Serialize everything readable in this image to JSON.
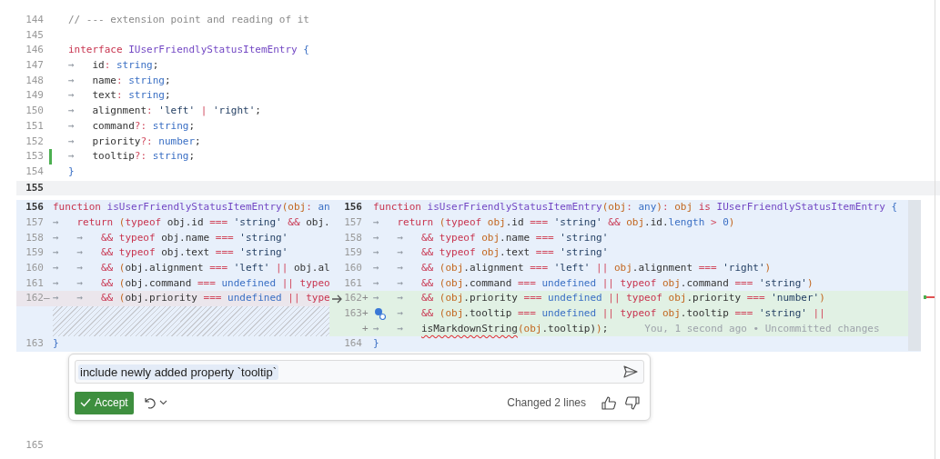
{
  "editor": {
    "lines_before": [
      {
        "number": "144",
        "modified": false,
        "tokens": [
          {
            "kind": "comment",
            "text": "// --- extension point and reading of it"
          }
        ]
      },
      {
        "number": "145",
        "modified": false
      },
      {
        "number": "146",
        "modified": false,
        "tokens": [
          {
            "kind": "kw",
            "text": "interface"
          },
          {
            "kind": "type",
            "text": " IUserFriendlyStatusItemEntry"
          },
          {
            "kind": "brace",
            "text": " {"
          }
        ]
      },
      {
        "number": "147",
        "modified": false,
        "tokens": [
          {
            "kind": "tab",
            "text": "→"
          },
          {
            "kind": "p",
            "text": "id"
          },
          {
            "kind": "op",
            "text": ":"
          },
          {
            "kind": "tn",
            "text": " string"
          },
          {
            "kind": "p",
            "text": ";"
          }
        ]
      },
      {
        "number": "148",
        "modified": false,
        "tokens": [
          {
            "kind": "tab",
            "text": "→"
          },
          {
            "kind": "p",
            "text": "name"
          },
          {
            "kind": "op",
            "text": ":"
          },
          {
            "kind": "tn",
            "text": " string"
          },
          {
            "kind": "p",
            "text": ";"
          }
        ]
      },
      {
        "number": "149",
        "modified": false,
        "tokens": [
          {
            "kind": "tab",
            "text": "→"
          },
          {
            "kind": "p",
            "text": "text"
          },
          {
            "kind": "op",
            "text": ":"
          },
          {
            "kind": "tn",
            "text": " string"
          },
          {
            "kind": "p",
            "text": ";"
          }
        ]
      },
      {
        "number": "150",
        "modified": false,
        "tokens": [
          {
            "kind": "tab",
            "text": "→"
          },
          {
            "kind": "p",
            "text": "alignment"
          },
          {
            "kind": "op",
            "text": ":"
          },
          {
            "kind": "str",
            "text": " 'left'"
          },
          {
            "kind": "op",
            "text": " |"
          },
          {
            "kind": "str",
            "text": " 'right'"
          },
          {
            "kind": "p",
            "text": ";"
          }
        ]
      },
      {
        "number": "151",
        "modified": false,
        "tokens": [
          {
            "kind": "tab",
            "text": "→"
          },
          {
            "kind": "p",
            "text": "command"
          },
          {
            "kind": "op",
            "text": "?:"
          },
          {
            "kind": "tn",
            "text": " string"
          },
          {
            "kind": "p",
            "text": ";"
          }
        ]
      },
      {
        "number": "152",
        "modified": false,
        "tokens": [
          {
            "kind": "tab",
            "text": "→"
          },
          {
            "kind": "p",
            "text": "priority"
          },
          {
            "kind": "op",
            "text": "?:"
          },
          {
            "kind": "tn",
            "text": " number"
          },
          {
            "kind": "p",
            "text": ";"
          }
        ]
      },
      {
        "number": "153",
        "modified": true,
        "tokens": [
          {
            "kind": "tab",
            "text": "→"
          },
          {
            "kind": "p",
            "text": "tooltip"
          },
          {
            "kind": "op",
            "text": "?:"
          },
          {
            "kind": "tn",
            "text": " string"
          },
          {
            "kind": "p",
            "text": ";"
          }
        ]
      },
      {
        "number": "154",
        "modified": false,
        "tokens": [
          {
            "kind": "brace",
            "text": "}"
          }
        ]
      }
    ],
    "current_line": {
      "number": "155"
    },
    "diff": {
      "original": [
        {
          "kind": "line",
          "number": "156",
          "current": true,
          "deleted": false,
          "tokens": [
            {
              "kind": "kw",
              "text": "function"
            },
            {
              "kind": "type",
              "text": " isUserFriendlyStatusItemEntry"
            },
            {
              "kind": "paren",
              "text": "("
            },
            {
              "kind": "obj",
              "text": "obj"
            },
            {
              "kind": "op",
              "text": ":"
            },
            {
              "kind": "tn",
              "text": " an"
            }
          ]
        },
        {
          "kind": "line",
          "number": "157",
          "current": false,
          "deleted": false,
          "tokens": [
            {
              "kind": "tab",
              "text": "→"
            },
            {
              "kind": "kw",
              "text": "return"
            },
            {
              "kind": "paren",
              "text": " ("
            },
            {
              "kind": "kw",
              "text": "typeof"
            },
            {
              "kind": "p",
              "text": " obj.id "
            },
            {
              "kind": "op",
              "text": "==="
            },
            {
              "kind": "str",
              "text": " 'string'"
            },
            {
              "kind": "kw",
              "text": " &&"
            },
            {
              "kind": "p",
              "text": " obj."
            }
          ]
        },
        {
          "kind": "line",
          "number": "158",
          "current": false,
          "deleted": false,
          "tokens": [
            {
              "kind": "tab",
              "text": "→"
            },
            {
              "kind": "tab",
              "text": "→"
            },
            {
              "kind": "kw",
              "text": "&&"
            },
            {
              "kind": "kw",
              "text": " typeof"
            },
            {
              "kind": "p",
              "text": " obj.name "
            },
            {
              "kind": "op",
              "text": "==="
            },
            {
              "kind": "str",
              "text": " 'string'"
            }
          ]
        },
        {
          "kind": "line",
          "number": "159",
          "current": false,
          "deleted": false,
          "tokens": [
            {
              "kind": "tab",
              "text": "→"
            },
            {
              "kind": "tab",
              "text": "→"
            },
            {
              "kind": "kw",
              "text": "&&"
            },
            {
              "kind": "kw",
              "text": " typeof"
            },
            {
              "kind": "p",
              "text": " obj.text "
            },
            {
              "kind": "op",
              "text": "==="
            },
            {
              "kind": "str",
              "text": " 'string'"
            }
          ]
        },
        {
          "kind": "line",
          "number": "160",
          "current": false,
          "deleted": false,
          "tokens": [
            {
              "kind": "tab",
              "text": "→"
            },
            {
              "kind": "tab",
              "text": "→"
            },
            {
              "kind": "kw",
              "text": "&&"
            },
            {
              "kind": "paren",
              "text": " ("
            },
            {
              "kind": "p",
              "text": "obj.alignment "
            },
            {
              "kind": "op",
              "text": "==="
            },
            {
              "kind": "str",
              "text": " 'left'"
            },
            {
              "kind": "op",
              "text": " ||"
            },
            {
              "kind": "p",
              "text": " obj.al"
            }
          ]
        },
        {
          "kind": "line",
          "number": "161",
          "current": false,
          "deleted": false,
          "tokens": [
            {
              "kind": "tab",
              "text": "→"
            },
            {
              "kind": "tab",
              "text": "→"
            },
            {
              "kind": "kw",
              "text": "&&"
            },
            {
              "kind": "paren",
              "text": " ("
            },
            {
              "kind": "p",
              "text": "obj.command "
            },
            {
              "kind": "op",
              "text": "==="
            },
            {
              "kind": "tn",
              "text": " undefined"
            },
            {
              "kind": "op",
              "text": " ||"
            },
            {
              "kind": "kw",
              "text": " typeo"
            }
          ]
        },
        {
          "kind": "line",
          "number": "162",
          "current": false,
          "deleted": true,
          "marker": "—",
          "tokens": [
            {
              "kind": "tab",
              "text": "→"
            },
            {
              "kind": "tab",
              "text": "→"
            },
            {
              "kind": "kw",
              "text": "&&"
            },
            {
              "kind": "paren",
              "text": " ("
            },
            {
              "kind": "p",
              "text": "obj.priority "
            },
            {
              "kind": "op",
              "text": "==="
            },
            {
              "kind": "tn",
              "text": " undefined"
            },
            {
              "kind": "op",
              "text": " ||"
            },
            {
              "kind": "kw",
              "text": " type"
            }
          ]
        },
        {
          "kind": "filler"
        },
        {
          "kind": "filler"
        },
        {
          "kind": "line",
          "number": "163",
          "current": false,
          "deleted": false,
          "tokens": [
            {
              "kind": "brace",
              "text": "}"
            }
          ]
        }
      ],
      "modified": [
        {
          "kind": "line",
          "number": "156",
          "current": true,
          "added": false,
          "tokens": [
            {
              "kind": "kw",
              "text": "function"
            },
            {
              "kind": "type",
              "text": " isUserFriendlyStatusItemEntry"
            },
            {
              "kind": "paren",
              "text": "("
            },
            {
              "kind": "obj",
              "text": "obj"
            },
            {
              "kind": "op",
              "text": ":"
            },
            {
              "kind": "tn",
              "text": " any"
            },
            {
              "kind": "paren",
              "text": ")"
            },
            {
              "kind": "op",
              "text": ":"
            },
            {
              "kind": "obj",
              "text": " obj"
            },
            {
              "kind": "kw",
              "text": " is"
            },
            {
              "kind": "type",
              "text": " IUserFriendlyStatusItemEntry"
            },
            {
              "kind": "brace",
              "text": " {"
            }
          ]
        },
        {
          "kind": "line",
          "number": "157",
          "current": false,
          "added": false,
          "tokens": [
            {
              "kind": "tab",
              "text": "→"
            },
            {
              "kind": "kw",
              "text": "return"
            },
            {
              "kind": "paren",
              "text": " ("
            },
            {
              "kind": "kw",
              "text": "typeof"
            },
            {
              "kind": "obj",
              "text": " obj"
            },
            {
              "kind": "p",
              "text": ".id "
            },
            {
              "kind": "op",
              "text": "==="
            },
            {
              "kind": "str",
              "text": " 'string'"
            },
            {
              "kind": "kw",
              "text": " &&"
            },
            {
              "kind": "obj",
              "text": " obj"
            },
            {
              "kind": "p",
              "text": ".id."
            },
            {
              "kind": "tn",
              "text": "length"
            },
            {
              "kind": "op",
              "text": " >"
            },
            {
              "kind": "tn",
              "text": " 0"
            },
            {
              "kind": "paren",
              "text": ")"
            }
          ]
        },
        {
          "kind": "line",
          "number": "158",
          "current": false,
          "added": false,
          "tokens": [
            {
              "kind": "tab",
              "text": "→"
            },
            {
              "kind": "tab",
              "text": "→"
            },
            {
              "kind": "kw",
              "text": "&&"
            },
            {
              "kind": "kw",
              "text": " typeof"
            },
            {
              "kind": "obj",
              "text": " obj"
            },
            {
              "kind": "p",
              "text": ".name "
            },
            {
              "kind": "op",
              "text": "==="
            },
            {
              "kind": "str",
              "text": " 'string'"
            }
          ]
        },
        {
          "kind": "line",
          "number": "159",
          "current": false,
          "added": false,
          "tokens": [
            {
              "kind": "tab",
              "text": "→"
            },
            {
              "kind": "tab",
              "text": "→"
            },
            {
              "kind": "kw",
              "text": "&&"
            },
            {
              "kind": "kw",
              "text": " typeof"
            },
            {
              "kind": "obj",
              "text": " obj"
            },
            {
              "kind": "p",
              "text": ".text "
            },
            {
              "kind": "op",
              "text": "==="
            },
            {
              "kind": "str",
              "text": " 'string'"
            }
          ]
        },
        {
          "kind": "line",
          "number": "160",
          "current": false,
          "added": false,
          "tokens": [
            {
              "kind": "tab",
              "text": "→"
            },
            {
              "kind": "tab",
              "text": "→"
            },
            {
              "kind": "kw",
              "text": "&&"
            },
            {
              "kind": "paren",
              "text": " ("
            },
            {
              "kind": "obj",
              "text": "obj"
            },
            {
              "kind": "p",
              "text": ".alignment "
            },
            {
              "kind": "op",
              "text": "==="
            },
            {
              "kind": "str",
              "text": " 'left'"
            },
            {
              "kind": "op",
              "text": " ||"
            },
            {
              "kind": "obj",
              "text": " obj"
            },
            {
              "kind": "p",
              "text": ".alignment "
            },
            {
              "kind": "op",
              "text": "==="
            },
            {
              "kind": "str",
              "text": " 'right'"
            },
            {
              "kind": "paren",
              "text": ")"
            }
          ]
        },
        {
          "kind": "line",
          "number": "161",
          "current": false,
          "added": false,
          "tokens": [
            {
              "kind": "tab",
              "text": "→"
            },
            {
              "kind": "tab",
              "text": "→"
            },
            {
              "kind": "kw",
              "text": "&&"
            },
            {
              "kind": "paren",
              "text": " ("
            },
            {
              "kind": "obj",
              "text": "obj"
            },
            {
              "kind": "p",
              "text": ".command "
            },
            {
              "kind": "op",
              "text": "==="
            },
            {
              "kind": "tn",
              "text": " undefined"
            },
            {
              "kind": "op",
              "text": " ||"
            },
            {
              "kind": "kw",
              "text": " typeof"
            },
            {
              "kind": "obj",
              "text": " obj"
            },
            {
              "kind": "p",
              "text": ".command "
            },
            {
              "kind": "op",
              "text": "==="
            },
            {
              "kind": "str",
              "text": " 'string'"
            },
            {
              "kind": "paren",
              "text": ")"
            }
          ]
        },
        {
          "kind": "line",
          "number": "162",
          "current": false,
          "added": true,
          "marker": "+",
          "revert": true,
          "tokens": [
            {
              "kind": "tab",
              "text": "→"
            },
            {
              "kind": "tab",
              "text": "→"
            },
            {
              "kind": "kw",
              "text": "&&"
            },
            {
              "kind": "paren",
              "text": " ("
            },
            {
              "kind": "obj",
              "text": "obj"
            },
            {
              "kind": "p",
              "text": ".priority "
            },
            {
              "kind": "op",
              "text": "==="
            },
            {
              "kind": "tn",
              "text": " undefined"
            },
            {
              "kind": "op",
              "text": " ||"
            },
            {
              "kind": "kw",
              "text": " typeof"
            },
            {
              "kind": "obj",
              "text": " obj"
            },
            {
              "kind": "p",
              "text": ".priority "
            },
            {
              "kind": "op",
              "text": "==="
            },
            {
              "kind": "str",
              "text": " 'number'"
            },
            {
              "kind": "paren",
              "text": ")"
            }
          ]
        },
        {
          "kind": "line",
          "number": "163",
          "current": false,
          "added": true,
          "marker": "+",
          "author": true,
          "tokens": [
            {
              "kind": "tab",
              "text": "→"
            },
            {
              "kind": "kw",
              "text": "&&"
            },
            {
              "kind": "paren",
              "text": " ("
            },
            {
              "kind": "obj",
              "text": "obj"
            },
            {
              "kind": "p",
              "text": ".tooltip "
            },
            {
              "kind": "op",
              "text": "==="
            },
            {
              "kind": "tn",
              "text": " undefined"
            },
            {
              "kind": "op",
              "text": " ||"
            },
            {
              "kind": "kw",
              "text": " typeof"
            },
            {
              "kind": "obj",
              "text": " obj"
            },
            {
              "kind": "p",
              "text": ".tooltip "
            },
            {
              "kind": "op",
              "text": "==="
            },
            {
              "kind": "str",
              "text": " 'string'"
            },
            {
              "kind": "op",
              "text": " ||"
            }
          ]
        },
        {
          "kind": "line",
          "current": false,
          "added": true,
          "marker": "+",
          "blame": "You, 1 second ago • Uncommitted changes",
          "tokens": [
            {
              "kind": "tab",
              "text": "→"
            },
            {
              "kind": "tab",
              "text": "→"
            },
            {
              "kind": "err",
              "text": "isMarkdownString"
            },
            {
              "kind": "paren",
              "text": "("
            },
            {
              "kind": "obj",
              "text": "obj"
            },
            {
              "kind": "p",
              "text": ".tooltip)"
            },
            {
              "kind": "paren",
              "text": ")"
            },
            {
              "kind": "p",
              "text": ";"
            }
          ]
        },
        {
          "kind": "line",
          "number": "164",
          "current": false,
          "added": false,
          "tokens": [
            {
              "kind": "brace",
              "text": "}"
            }
          ]
        }
      ]
    },
    "lines_after": [
      {
        "number": "165"
      }
    ]
  },
  "inline_chat": {
    "prompt": "include newly added property `tooltip`",
    "accept_label": "Accept",
    "summary": "Changed 2 lines"
  }
}
